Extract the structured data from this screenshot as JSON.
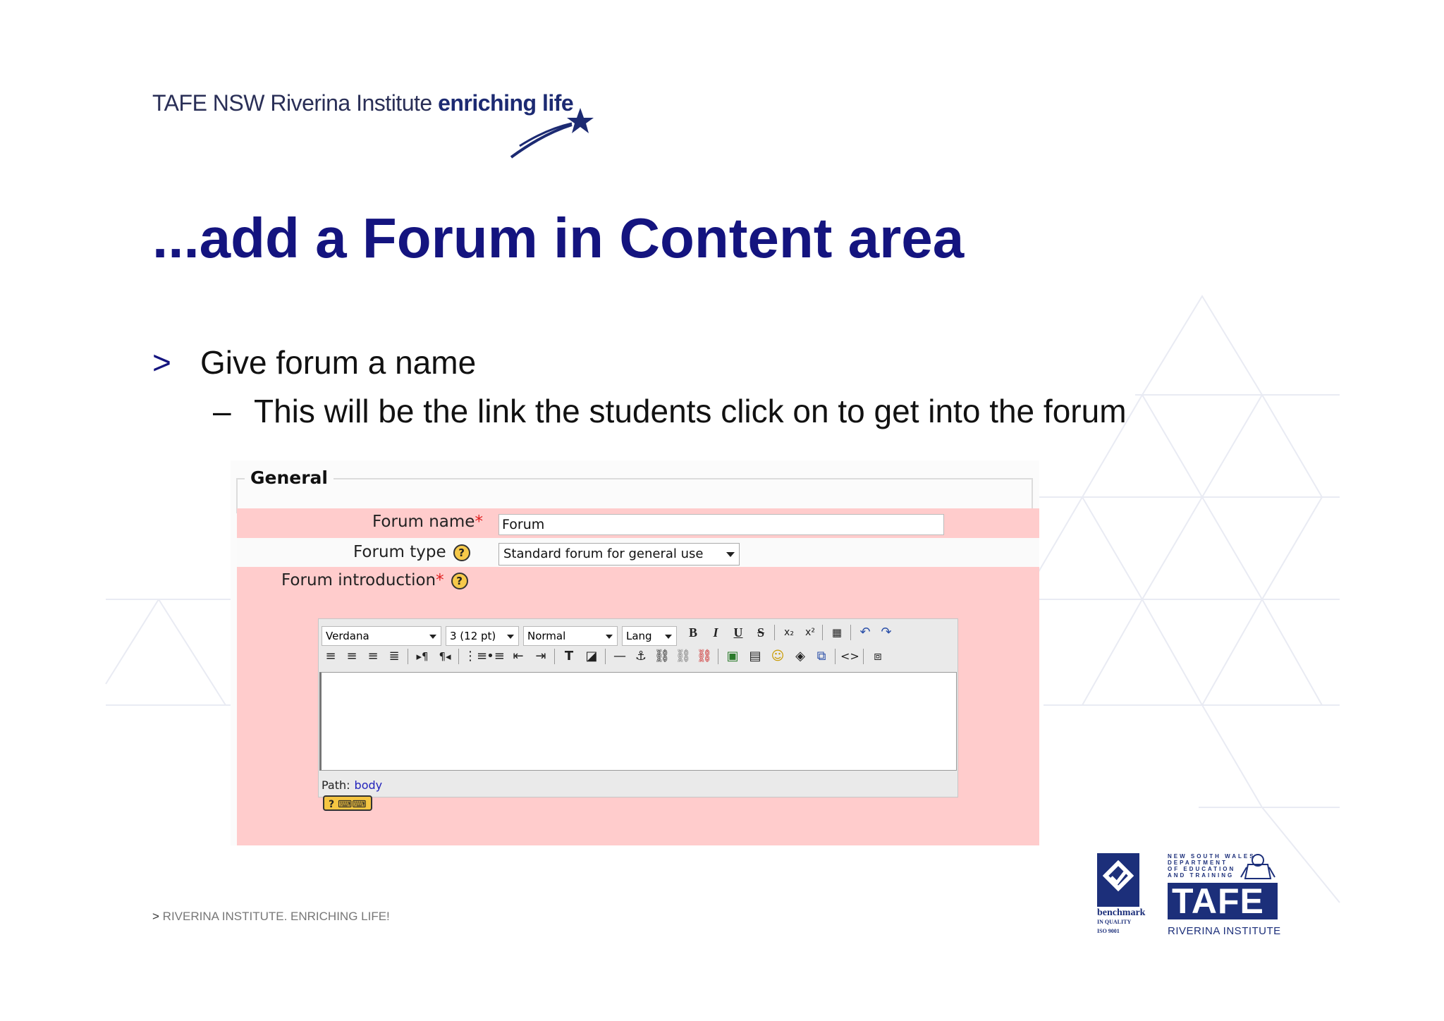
{
  "header": {
    "logo_text_regular": "TAFE NSW Riverina Institute ",
    "logo_text_bold": "enriching life"
  },
  "slide": {
    "title": "...add a Forum in Content area",
    "bullets": [
      {
        "marker": ">",
        "text": "Give forum a name"
      },
      {
        "marker": "–",
        "text": "This will be the link the students click on to get into the forum"
      }
    ]
  },
  "form": {
    "legend": "General",
    "forum_name_label": "Forum name",
    "forum_name_required": "*",
    "forum_name_value": "Forum",
    "forum_type_label": "Forum type",
    "forum_type_value": "Standard forum for general use",
    "forum_intro_label": "Forum introduction",
    "forum_intro_required": "*",
    "help_glyph": "?",
    "editor": {
      "font_family": "Verdana",
      "font_size": "3 (12 pt)",
      "format": "Normal",
      "lang": "Lang",
      "path_label": "Path:",
      "path_value": "body"
    },
    "colors": {
      "required_row": "#ffcccc",
      "required_marker": "#e02020"
    }
  },
  "footer": {
    "marker": ">",
    "text": "RIVERINA INSTITUTE. ENRICHING LIFE!"
  },
  "logos": {
    "benchmark_name": "benchmark",
    "benchmark_sub1": "IN QUALITY",
    "benchmark_sub2": "ISO 9001",
    "dept_line1": "NEW SOUTH WALES",
    "dept_line2": "DEPARTMENT",
    "dept_line3": "OF EDUCATION",
    "dept_line4": "AND TRAINING",
    "tafe_word": "TAFE",
    "tafe_institute": "RIVERINA INSTITUTE"
  },
  "colors": {
    "title": "#14147f",
    "brand_blue": "#1c2f7a"
  }
}
